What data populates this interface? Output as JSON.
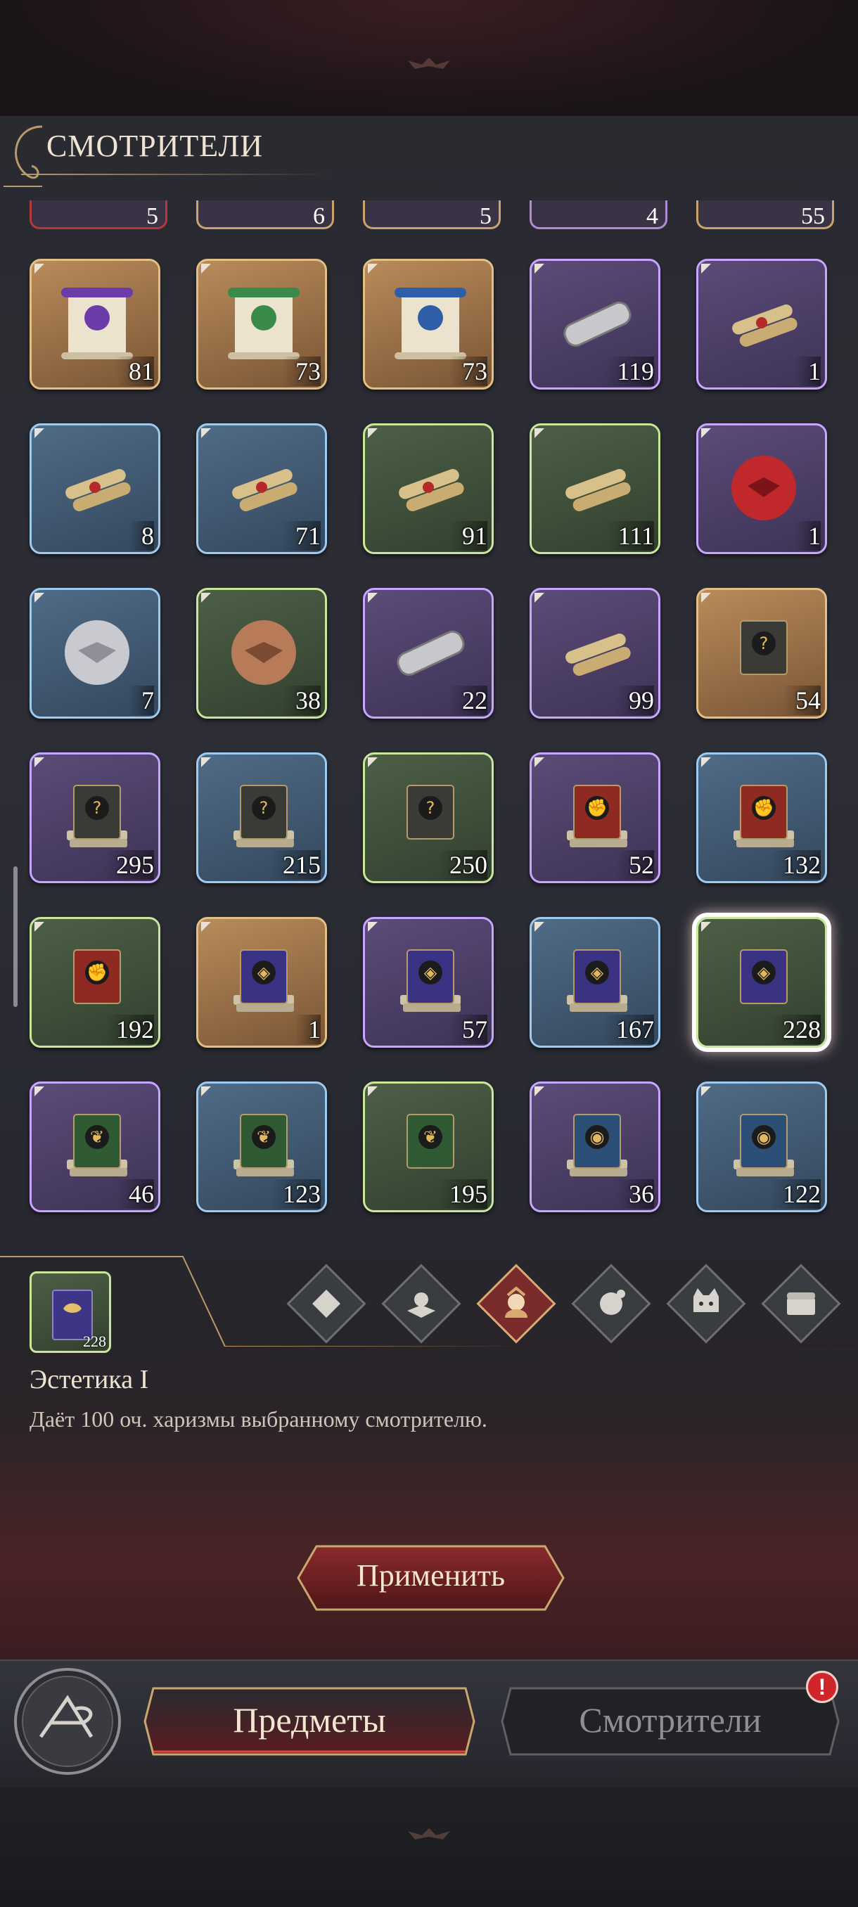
{
  "header": {
    "title": "СМОТРИТЕЛИ"
  },
  "top_row_counts": [
    "5",
    "6",
    "5",
    "4",
    "55"
  ],
  "items": [
    {
      "icon": "purple-mask-scroll-icon",
      "rarity": "orange",
      "count": "81"
    },
    {
      "icon": "green-leaf-scroll-icon",
      "rarity": "orange",
      "count": "73"
    },
    {
      "icon": "blue-eye-scroll-icon",
      "rarity": "orange",
      "count": "73"
    },
    {
      "icon": "silver-scroll-case-icon",
      "rarity": "purple",
      "count": "119"
    },
    {
      "icon": "sealed-scroll-bundle-icon",
      "rarity": "purple",
      "count": "1"
    },
    {
      "icon": "sealed-scroll-bundle-icon",
      "rarity": "blue",
      "count": "8"
    },
    {
      "icon": "sealed-scroll-bundle-icon",
      "rarity": "blue",
      "count": "71"
    },
    {
      "icon": "sealed-scroll-pile-icon",
      "rarity": "green",
      "count": "91"
    },
    {
      "icon": "rolled-scroll-icon",
      "rarity": "green",
      "count": "111"
    },
    {
      "icon": "red-wax-seal-icon",
      "rarity": "purple",
      "count": "1"
    },
    {
      "icon": "silver-wax-seal-icon",
      "rarity": "blue",
      "count": "7"
    },
    {
      "icon": "bronze-wax-seal-icon",
      "rarity": "green",
      "count": "38"
    },
    {
      "icon": "silver-scroll-case-icon",
      "rarity": "purple",
      "count": "22"
    },
    {
      "icon": "rolled-scrolls-icon",
      "rarity": "purple",
      "count": "99"
    },
    {
      "icon": "mystery-book-icon",
      "rarity": "orange",
      "count": "54"
    },
    {
      "icon": "mystery-book-stack-icon",
      "rarity": "purple",
      "count": "295"
    },
    {
      "icon": "mystery-book-stack-icon",
      "rarity": "blue",
      "count": "215"
    },
    {
      "icon": "mystery-book-icon",
      "rarity": "green",
      "count": "250"
    },
    {
      "icon": "fist-book-stack-icon",
      "rarity": "purple",
      "count": "52"
    },
    {
      "icon": "fist-book-stack-icon",
      "rarity": "blue",
      "count": "132"
    },
    {
      "icon": "fist-book-icon",
      "rarity": "green",
      "count": "192"
    },
    {
      "icon": "mask-book-stack-icon",
      "rarity": "orange",
      "count": "1"
    },
    {
      "icon": "mask-book-stack-icon",
      "rarity": "purple",
      "count": "57"
    },
    {
      "icon": "mask-book-stack-icon",
      "rarity": "blue",
      "count": "167"
    },
    {
      "icon": "mask-book-icon",
      "rarity": "green",
      "count": "228",
      "selected": true
    },
    {
      "icon": "leaf-book-stack-icon",
      "rarity": "purple",
      "count": "46"
    },
    {
      "icon": "leaf-book-stack-icon",
      "rarity": "blue",
      "count": "123"
    },
    {
      "icon": "leaf-book-icon",
      "rarity": "green",
      "count": "195"
    },
    {
      "icon": "eye-book-stack-icon",
      "rarity": "purple",
      "count": "36"
    },
    {
      "icon": "eye-book-stack-icon",
      "rarity": "blue",
      "count": "122"
    }
  ],
  "categories": [
    {
      "icon": "diamond-grid-icon",
      "active": false
    },
    {
      "icon": "bat-flower-icon",
      "active": false
    },
    {
      "icon": "woman-portrait-icon",
      "active": true
    },
    {
      "icon": "paw-ball-icon",
      "active": false
    },
    {
      "icon": "cat-face-icon",
      "active": false
    },
    {
      "icon": "chest-icon",
      "active": false
    }
  ],
  "detail": {
    "count": "228",
    "name": "Эстетика I",
    "description": "Даёт 100 оч. харизмы выбранному смотрителю.",
    "apply_label": "Применить"
  },
  "nav": {
    "tab_items": "Предметы",
    "tab_keepers": "Смотрители",
    "badge": "!"
  },
  "colors": {
    "orange": "#e2bf85",
    "purple": "#c8a6ff",
    "blue": "#9fcaf0",
    "green": "#c9e69a",
    "accent_red": "#d0262b"
  }
}
